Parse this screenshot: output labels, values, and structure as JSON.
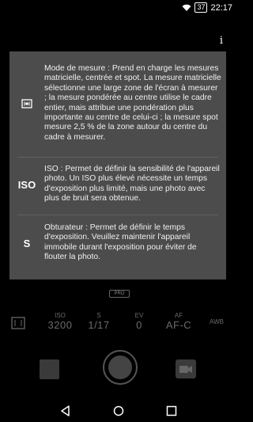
{
  "status_bar": {
    "battery": "37",
    "time": "22:17"
  },
  "info_button": "i",
  "help_overlay": {
    "items": [
      {
        "icon": "metering-icon",
        "label": "",
        "text": "Mode de mesure : Prend en charge les mesures matricielle, centrée et spot. La mesure matricielle sélectionne une large zone de l'écran à mesurer ; la mesure pondérée au centre utilise le cadre entier, mais attribue une pondération plus importante au centre de celui-ci ; la mesure spot mesure 2,5 % de la zone autour du centre du cadre à mesurer."
      },
      {
        "icon": "iso-icon",
        "label": "ISO",
        "text": "ISO : Permet de définir la sensibilité de l'appareil photo. Un ISO plus élevé nécessite un temps d'exposition plus limité, mais une photo avec plus de bruit sera obtenue."
      },
      {
        "icon": "shutter-speed-icon",
        "label": "S",
        "text": "Obturateur : Permet de définir le temps d'exposition. Veuillez maintenir l'appareil immobile durant l'exposition pour éviter de flouter la photo."
      }
    ]
  },
  "pro_tab": "PRO",
  "camera_settings": {
    "iso": {
      "label": "ISO",
      "value": "3200"
    },
    "shutter": {
      "label": "S",
      "value": "1/17"
    },
    "ev": {
      "label": "EV",
      "value": "0"
    },
    "af": {
      "label": "AF",
      "value": "AF-C"
    },
    "awb": {
      "label": "AWB"
    }
  },
  "colors": {
    "overlay": "#505050",
    "dim_text": "#6a6a6a"
  }
}
